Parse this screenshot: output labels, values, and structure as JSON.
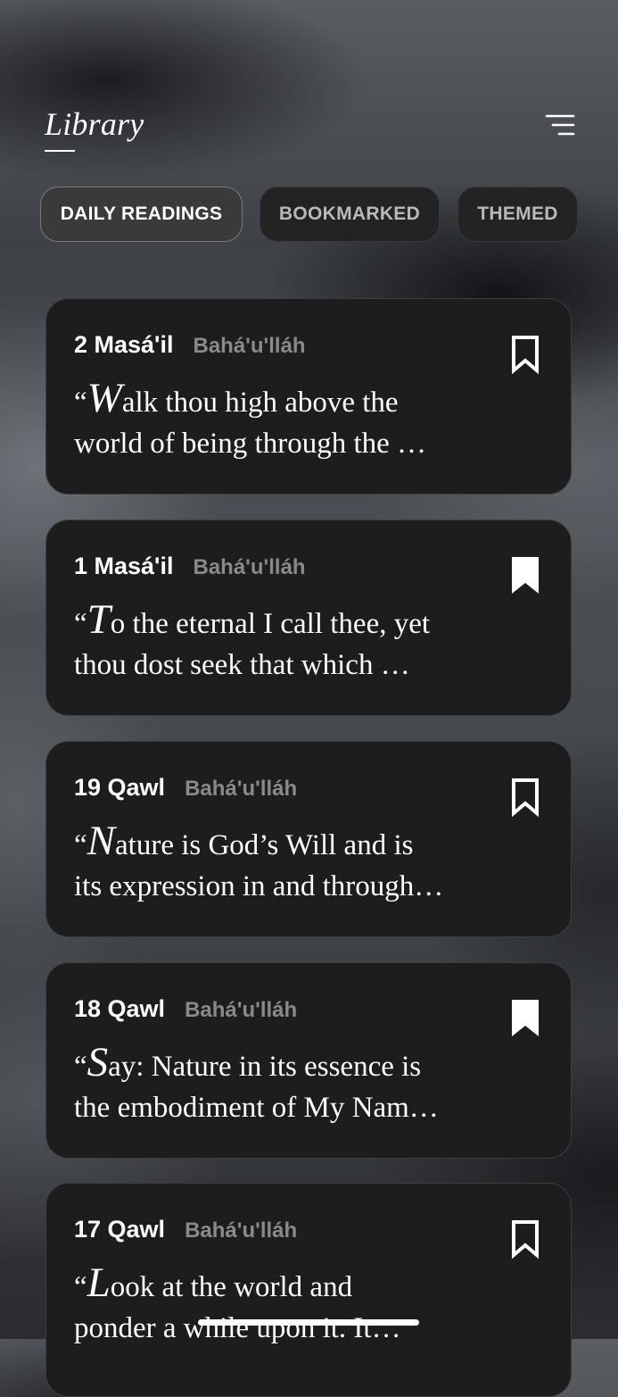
{
  "header": {
    "title": "Library"
  },
  "tabs": [
    {
      "label": "DAILY READINGS",
      "active": true
    },
    {
      "label": "BOOKMARKED",
      "active": false
    },
    {
      "label": "THEMED",
      "active": false
    }
  ],
  "cards": [
    {
      "reference": "2 Masá'il",
      "author": "Bahá'u'lláh",
      "quote_open": "“",
      "quote_initial": "W",
      "quote_line1": "alk thou high above the",
      "quote_line2": "world of being through the …",
      "bookmarked": false
    },
    {
      "reference": "1 Masá'il",
      "author": "Bahá'u'lláh",
      "quote_open": "“",
      "quote_initial": "T",
      "quote_line1": "o the eternal I call thee, yet",
      "quote_line2": "thou dost seek that which …",
      "bookmarked": true
    },
    {
      "reference": "19 Qawl",
      "author": "Bahá'u'lláh",
      "quote_open": "“",
      "quote_initial": "N",
      "quote_line1": "ature is God’s Will and is",
      "quote_line2": "its expression in and through…",
      "bookmarked": false
    },
    {
      "reference": "18 Qawl",
      "author": "Bahá'u'lláh",
      "quote_open": "“",
      "quote_initial": "S",
      "quote_line1": "ay: Nature in its essence is",
      "quote_line2": "the embodiment of My Nam…",
      "bookmarked": true
    },
    {
      "reference": "17 Qawl",
      "author": "Bahá'u'lláh",
      "quote_open": "“",
      "quote_initial": "L",
      "quote_line1": "ook at the world and",
      "quote_line2": "ponder a while upon it. It…",
      "bookmarked": false
    }
  ],
  "icons": {
    "menu": "menu-icon",
    "bookmark_outline": "bookmark-outline-icon",
    "bookmark_filled": "bookmark-filled-icon"
  },
  "colors": {
    "card_background": "#1d1d1d",
    "author_text": "#8a8a8a",
    "active_tab_background": "#3a3a3a"
  }
}
